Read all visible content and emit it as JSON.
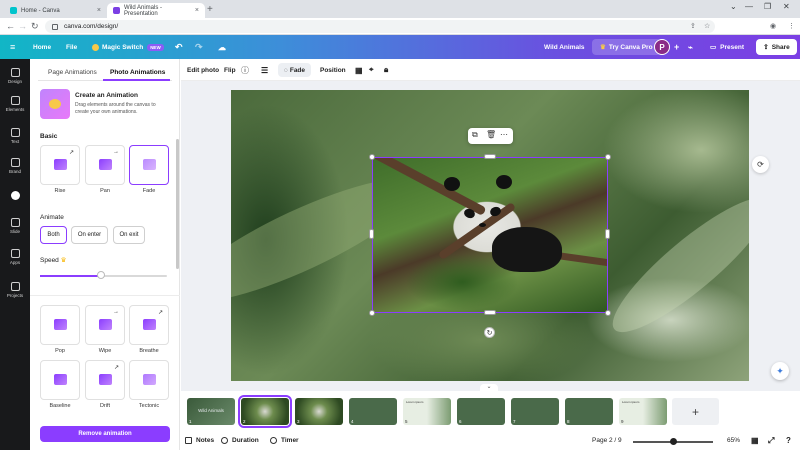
{
  "browser": {
    "tabs": [
      {
        "label": "Home - Canva",
        "active": false
      },
      {
        "label": "Wild Animals - Presentation",
        "active": true
      }
    ],
    "new_tab": "+",
    "url": "canva.com/design/",
    "window_controls": [
      "⌄",
      "—",
      "❐",
      "✕"
    ]
  },
  "topbar": {
    "menu_icon": "hamburger-icon",
    "home": "Home",
    "file": "File",
    "magic_switch": "Magic Switch",
    "new_badge": "NEW",
    "design_title": "Wild Animals",
    "try_pro": "Try Canva Pro",
    "avatar_letter": "P",
    "present": "Present",
    "share": "Share",
    "gradient_colors": [
      "#11b6c6",
      "#7b3fe4"
    ]
  },
  "rail": {
    "items": [
      {
        "label": "Design",
        "icon": "design-icon"
      },
      {
        "label": "Elements",
        "icon": "elements-icon"
      },
      {
        "label": "Text",
        "icon": "text-icon"
      },
      {
        "label": "Brand",
        "icon": "brand-icon"
      },
      {
        "label": "",
        "icon": "canva-ai-icon"
      },
      {
        "label": "Slide",
        "icon": "slide-icon"
      },
      {
        "label": "Apps",
        "icon": "apps-icon"
      },
      {
        "label": "Projects",
        "icon": "projects-icon"
      }
    ]
  },
  "panel": {
    "tabs": [
      "Page Animations",
      "Photo Animations"
    ],
    "active_tab": "Photo Animations",
    "create_title": "Create an Animation",
    "create_desc": "Drag elements around the canvas to create your own animations.",
    "basic_heading": "Basic",
    "basic": [
      {
        "label": "Rise",
        "selected": false,
        "arrow": "↗"
      },
      {
        "label": "Pan",
        "selected": false,
        "arrow": "→"
      },
      {
        "label": "Fade",
        "selected": true,
        "arrow": ""
      }
    ],
    "animate_heading": "Animate",
    "animate_options": [
      {
        "label": "Both",
        "selected": true
      },
      {
        "label": "On enter",
        "selected": false
      },
      {
        "label": "On exit",
        "selected": false
      }
    ],
    "speed_label": "Speed",
    "speed_value": 0.48,
    "more": [
      {
        "label": "Pop",
        "arrow": ""
      },
      {
        "label": "Wipe",
        "arrow": "→"
      },
      {
        "label": "Breathe",
        "arrow": "↗"
      },
      {
        "label": "Baseline",
        "arrow": ""
      },
      {
        "label": "Drift",
        "arrow": "↗"
      },
      {
        "label": "Tectonic",
        "arrow": ""
      }
    ],
    "remove_button": "Remove animation",
    "accent_color": "#8b3dff"
  },
  "context_toolbar": {
    "edit_photo": "Edit photo",
    "flip": "Flip",
    "fade": "Fade",
    "position": "Position"
  },
  "filmstrip": {
    "slides": [
      {
        "num": "1",
        "caption": "Wild Animals",
        "style": "slide1"
      },
      {
        "num": "2",
        "caption": "",
        "style": "photo",
        "selected": true
      },
      {
        "num": "3",
        "caption": "",
        "style": "photo"
      },
      {
        "num": "4",
        "caption": "",
        "style": "dark"
      },
      {
        "num": "5",
        "caption": "Lorem ipsum",
        "style": "light"
      },
      {
        "num": "6",
        "caption": "",
        "style": "dark"
      },
      {
        "num": "7",
        "caption": "",
        "style": "dark"
      },
      {
        "num": "8",
        "caption": "",
        "style": "dark"
      },
      {
        "num": "9",
        "caption": "Lorem ipsum",
        "style": "light"
      }
    ],
    "add": "+"
  },
  "footer": {
    "notes": "Notes",
    "duration": "Duration",
    "timer": "Timer",
    "page": "Page 2 / 9",
    "zoom": "65%"
  }
}
